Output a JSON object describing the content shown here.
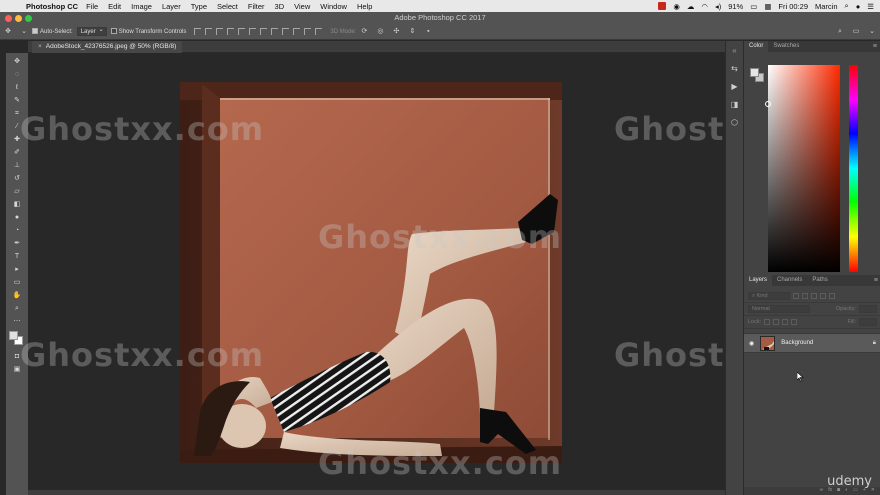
{
  "menubar": {
    "app_name": "Photoshop CC",
    "items": [
      "File",
      "Edit",
      "Image",
      "Layer",
      "Type",
      "Select",
      "Filter",
      "3D",
      "View",
      "Window",
      "Help"
    ],
    "battery": "91%",
    "clock": "Fri 00:29",
    "user": "Marcin"
  },
  "window": {
    "title": "Adobe Photoshop CC 2017"
  },
  "options": {
    "auto_select_label": "Auto-Select:",
    "auto_select_value": "Layer",
    "transform_label": "Show Transform Controls",
    "mode_3d": "3D Mode:"
  },
  "document": {
    "tab_label": "AdobeStock_42376526.jpeg @ 50% (RGB/8)"
  },
  "toolbar": {
    "tools": [
      "move-tool",
      "marquee-tool",
      "lasso-tool",
      "quick-select-tool",
      "crop-tool",
      "eyedropper-tool",
      "healing-brush-tool",
      "brush-tool",
      "clone-stamp-tool",
      "history-brush-tool",
      "eraser-tool",
      "gradient-tool",
      "blur-tool",
      "dodge-tool",
      "pen-tool",
      "type-tool",
      "path-select-tool",
      "rectangle-tool",
      "hand-tool",
      "zoom-tool",
      "edit-toolbar"
    ]
  },
  "panels": {
    "color_tab": "Color",
    "swatches_tab": "Swatches",
    "layers_tab": "Layers",
    "channels_tab": "Channels",
    "paths_tab": "Paths",
    "kind_label": "Kind",
    "blend_mode": "Normal",
    "opacity_label": "Opacity:",
    "lock_label": "Lock:",
    "fill_label": "Fill:",
    "layer_name": "Background"
  },
  "watermark": "Ghostxx.com",
  "branding": "udemy",
  "colors": {
    "photo_wall": "#a55b43",
    "ui_panel": "#535353",
    "canvas_bg": "#282828"
  }
}
